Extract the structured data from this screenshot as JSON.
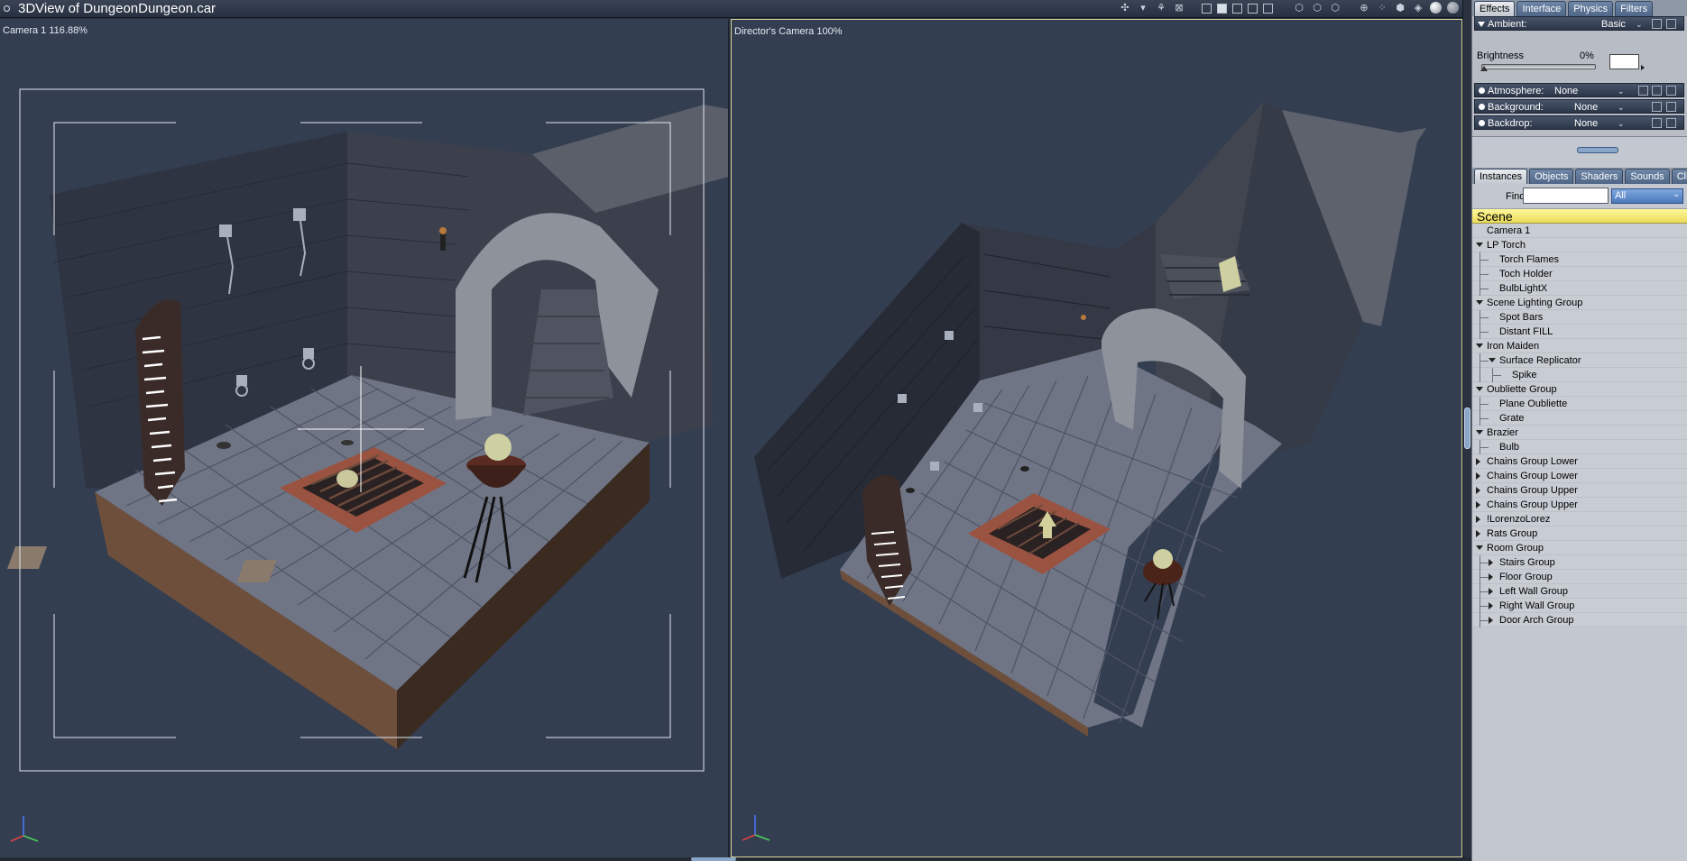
{
  "window": {
    "title": "3DView of DungeonDungeon.car"
  },
  "viewports": {
    "left_label": "Camera 1 116.88%",
    "right_label": "Director's Camera 100%"
  },
  "toolbar_icons": [
    "camera-tools-icon",
    "light-icon",
    "scene-icon",
    "target-icon",
    "layout-single-icon",
    "layout-double-icon",
    "layout-triple-icon",
    "layout-quad-icon",
    "layout-four-icon",
    "render-icon",
    "render2-icon",
    "render3-icon",
    "transform-icon",
    "move-icon",
    "cube-icon",
    "sphere-icon",
    "sphere-light-icon"
  ],
  "colors": {
    "viewport_bg": "#333e51",
    "active_border": "#d9d49a",
    "scene_header": "#f2e870",
    "tab_blue": "#5a7196"
  },
  "panel": {
    "top_tabs": [
      "Effects",
      "Interface",
      "Physics",
      "Filters"
    ],
    "effects": {
      "ambient_label": "Ambient:",
      "ambient_value": "Basic",
      "brightness_label": "Brightness",
      "brightness_value": "0%",
      "brightness_level": 0,
      "atmosphere_label": "Atmosphere:",
      "atmosphere_value": "None",
      "background_label": "Background:",
      "background_value": "None",
      "backdrop_label": "Backdrop:",
      "backdrop_value": "None"
    },
    "bottom_tabs": [
      "Instances",
      "Objects",
      "Shaders",
      "Sounds",
      "Clips"
    ],
    "find_label": "Find:",
    "find_value": "",
    "filter_value": "All",
    "tree_header": "Scene",
    "tree": [
      {
        "label": "Camera 1",
        "depth": 0,
        "exp": "none"
      },
      {
        "label": "LP Torch",
        "depth": 0,
        "exp": "open"
      },
      {
        "label": "Torch Flames",
        "depth": 1,
        "exp": "none"
      },
      {
        "label": "Toch Holder",
        "depth": 1,
        "exp": "none"
      },
      {
        "label": "BulbLightX",
        "depth": 1,
        "exp": "none"
      },
      {
        "label": "Scene Lighting Group",
        "depth": 0,
        "exp": "open"
      },
      {
        "label": "Spot Bars",
        "depth": 1,
        "exp": "none"
      },
      {
        "label": "Distant FILL",
        "depth": 1,
        "exp": "none"
      },
      {
        "label": "Iron Maiden",
        "depth": 0,
        "exp": "open"
      },
      {
        "label": "Surface Replicator",
        "depth": 1,
        "exp": "open"
      },
      {
        "label": "Spike",
        "depth": 2,
        "exp": "none"
      },
      {
        "label": "Oubliette Group",
        "depth": 0,
        "exp": "open"
      },
      {
        "label": "Plane Oubliette",
        "depth": 1,
        "exp": "none"
      },
      {
        "label": "Grate",
        "depth": 1,
        "exp": "none"
      },
      {
        "label": "Brazier",
        "depth": 0,
        "exp": "open"
      },
      {
        "label": "Bulb",
        "depth": 1,
        "exp": "none"
      },
      {
        "label": "Chains Group Lower",
        "depth": 0,
        "exp": "closed"
      },
      {
        "label": "Chains Group Lower",
        "depth": 0,
        "exp": "closed"
      },
      {
        "label": "Chains Group Upper",
        "depth": 0,
        "exp": "closed"
      },
      {
        "label": "Chains Group Upper",
        "depth": 0,
        "exp": "closed"
      },
      {
        "label": "!LorenzoLorez",
        "depth": 0,
        "exp": "closed"
      },
      {
        "label": "Rats Group",
        "depth": 0,
        "exp": "closed"
      },
      {
        "label": "Room Group",
        "depth": 0,
        "exp": "open"
      },
      {
        "label": "Stairs Group",
        "depth": 1,
        "exp": "closed"
      },
      {
        "label": "Floor Group",
        "depth": 1,
        "exp": "closed"
      },
      {
        "label": "Left Wall Group",
        "depth": 1,
        "exp": "closed"
      },
      {
        "label": "Right Wall Group",
        "depth": 1,
        "exp": "closed"
      },
      {
        "label": "Door Arch Group",
        "depth": 1,
        "exp": "closed"
      }
    ]
  }
}
